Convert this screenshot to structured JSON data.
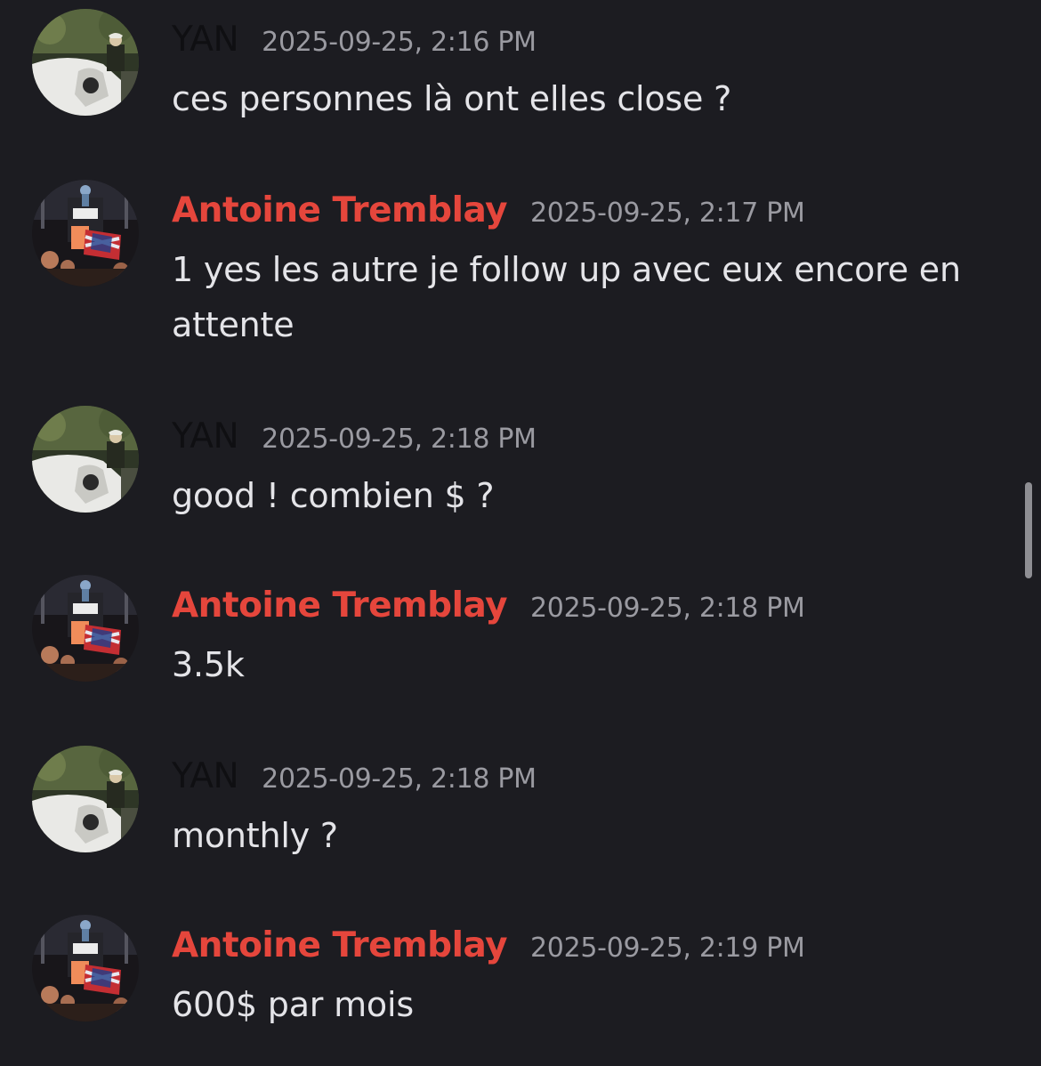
{
  "colors": {
    "background": "#1c1c21",
    "yan_name": "#0f0f12",
    "antoine_name": "#e5463c",
    "timestamp": "#9a9aa1",
    "message_text": "#e4e4e8"
  },
  "messages": [
    {
      "author": "YAN",
      "timestamp": "2025-09-25, 2:16 PM",
      "text": "ces personnes là ont elles close ?"
    },
    {
      "author": "Antoine Tremblay",
      "timestamp": "2025-09-25, 2:17 PM",
      "text": "1 yes les autre je follow up avec eux encore en attente"
    },
    {
      "author": "YAN",
      "timestamp": "2025-09-25, 2:18 PM",
      "text": "good ! combien $ ?"
    },
    {
      "author": "Antoine Tremblay",
      "timestamp": "2025-09-25, 2:18 PM",
      "text": "3.5k"
    },
    {
      "author": "YAN",
      "timestamp": "2025-09-25, 2:18 PM",
      "text": "monthly ?"
    },
    {
      "author": "Antoine Tremblay",
      "timestamp": "2025-09-25, 2:19 PM",
      "text": "600$ par mois"
    }
  ]
}
